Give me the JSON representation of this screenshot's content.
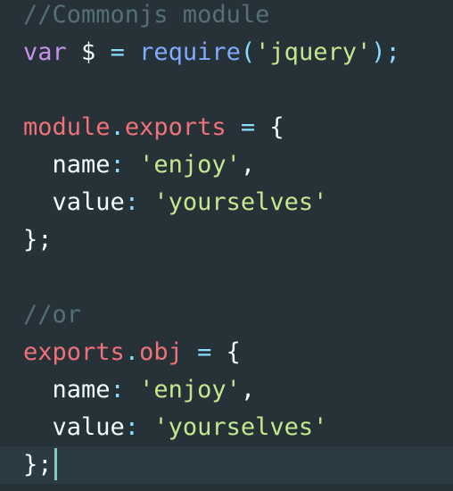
{
  "colors": {
    "background": "#263238",
    "active_line": "#2c3b41",
    "cursor": "#80cbc4",
    "comment": "#546e7a",
    "keyword": "#c792ea",
    "function": "#82aaff",
    "string": "#c3e88d",
    "object": "#f07178",
    "operator": "#89ddff",
    "text": "#eeffff"
  },
  "code": {
    "line1": {
      "comment": "//Commonjs module"
    },
    "line2": {
      "keyword": "var",
      "ident": "$",
      "op": "=",
      "fn": "require",
      "open": "(",
      "str": "'jquery'",
      "close": ")",
      "semi": ";"
    },
    "line4": {
      "obj": "module",
      "dot": ".",
      "prop": "exports",
      "op": "=",
      "brace": "{"
    },
    "line5": {
      "key": "name",
      "colon": ":",
      "str": "'enjoy'",
      "comma": ","
    },
    "line6": {
      "key": "value",
      "colon": ":",
      "str": "'yourselves'"
    },
    "line7": {
      "close": "};"
    },
    "line9": {
      "comment": "//or"
    },
    "line10": {
      "obj": "exports",
      "dot": ".",
      "prop": "obj",
      "op": "=",
      "brace": "{"
    },
    "line11": {
      "key": "name",
      "colon": ":",
      "str": "'enjoy'",
      "comma": ","
    },
    "line12": {
      "key": "value",
      "colon": ":",
      "str": "'yourselves'"
    },
    "line13": {
      "close": "};"
    }
  }
}
